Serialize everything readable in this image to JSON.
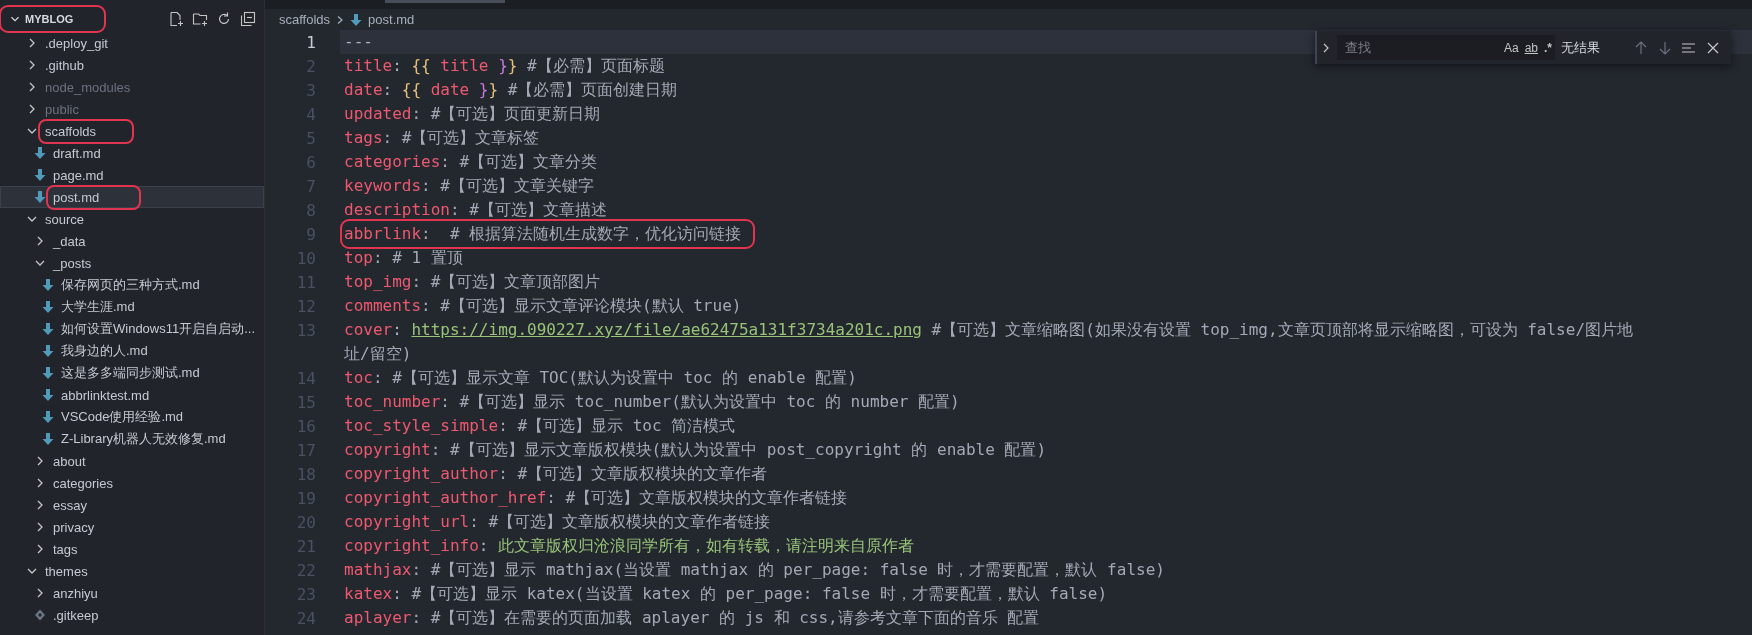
{
  "explorer": {
    "title": "MYBLOG",
    "expanded": true,
    "annotated": true,
    "tree": [
      {
        "name": ".deploy_git",
        "kind": "folder",
        "expanded": false,
        "dimmed": false,
        "selected": false,
        "annotated": false
      },
      {
        "name": ".github",
        "kind": "folder",
        "expanded": false,
        "dimmed": false,
        "selected": false,
        "annotated": false
      },
      {
        "name": "node_modules",
        "kind": "folder",
        "expanded": false,
        "dimmed": true,
        "selected": false,
        "annotated": false
      },
      {
        "name": "public",
        "kind": "folder",
        "expanded": false,
        "dimmed": true,
        "selected": false,
        "annotated": false
      },
      {
        "name": "scaffolds",
        "kind": "folder",
        "expanded": true,
        "dimmed": false,
        "selected": false,
        "annotated": true,
        "children": [
          {
            "name": "draft.md",
            "kind": "markdown",
            "dimmed": false,
            "selected": false,
            "annotated": false
          },
          {
            "name": "page.md",
            "kind": "markdown",
            "dimmed": false,
            "selected": false,
            "annotated": false
          },
          {
            "name": "post.md",
            "kind": "markdown",
            "dimmed": false,
            "selected": true,
            "annotated": true
          }
        ]
      },
      {
        "name": "source",
        "kind": "folder",
        "expanded": true,
        "dimmed": false,
        "selected": false,
        "annotated": false,
        "children": [
          {
            "name": "_data",
            "kind": "folder",
            "expanded": false,
            "dimmed": false,
            "selected": false,
            "annotated": false
          },
          {
            "name": "_posts",
            "kind": "folder",
            "expanded": true,
            "dimmed": false,
            "selected": false,
            "annotated": false,
            "children": [
              {
                "name": "保存网页的三种方式.md",
                "kind": "markdown",
                "dimmed": false,
                "selected": false,
                "annotated": false
              },
              {
                "name": "大学生涯.md",
                "kind": "markdown",
                "dimmed": false,
                "selected": false,
                "annotated": false
              },
              {
                "name": "如何设置Windows11开启自启动...",
                "kind": "markdown",
                "dimmed": false,
                "selected": false,
                "annotated": false
              },
              {
                "name": "我身边的人.md",
                "kind": "markdown",
                "dimmed": false,
                "selected": false,
                "annotated": false
              },
              {
                "name": "这是多多端同步测试.md",
                "kind": "markdown",
                "dimmed": false,
                "selected": false,
                "annotated": false
              },
              {
                "name": "abbrlinktest.md",
                "kind": "markdown",
                "dimmed": false,
                "selected": false,
                "annotated": false
              },
              {
                "name": "VSCode使用经验.md",
                "kind": "markdown",
                "dimmed": false,
                "selected": false,
                "annotated": false
              },
              {
                "name": "Z-Library机器人无效修复.md",
                "kind": "markdown",
                "dimmed": false,
                "selected": false,
                "annotated": false
              }
            ]
          },
          {
            "name": "about",
            "kind": "folder",
            "expanded": false,
            "dimmed": false,
            "selected": false,
            "annotated": false
          },
          {
            "name": "categories",
            "kind": "folder",
            "expanded": false,
            "dimmed": false,
            "selected": false,
            "annotated": false
          },
          {
            "name": "essay",
            "kind": "folder",
            "expanded": false,
            "dimmed": false,
            "selected": false,
            "annotated": false
          },
          {
            "name": "privacy",
            "kind": "folder",
            "expanded": false,
            "dimmed": false,
            "selected": false,
            "annotated": false
          },
          {
            "name": "tags",
            "kind": "folder",
            "expanded": false,
            "dimmed": false,
            "selected": false,
            "annotated": false
          }
        ]
      },
      {
        "name": "themes",
        "kind": "folder",
        "expanded": true,
        "dimmed": false,
        "selected": false,
        "annotated": false,
        "children": [
          {
            "name": "anzhiyu",
            "kind": "folder",
            "expanded": false,
            "dimmed": false,
            "selected": false,
            "annotated": false
          },
          {
            "name": ".gitkeep",
            "kind": "file",
            "dimmed": false,
            "selected": false,
            "annotated": false
          }
        ]
      }
    ]
  },
  "breadcrumb": [
    {
      "text": "scaffolds",
      "kind": "folder"
    },
    {
      "text": "post.md",
      "kind": "markdown"
    }
  ],
  "editor": {
    "lines": [
      {
        "number": "1",
        "current": true,
        "annotated": false,
        "segments": [
          {
            "kind": "punct",
            "text": "---"
          }
        ]
      },
      {
        "number": "2",
        "current": false,
        "annotated": false,
        "segments": [
          {
            "kind": "key",
            "text": "title"
          },
          {
            "kind": "punct",
            "text": ": "
          },
          {
            "kind": "bracket-gold",
            "text": "{{"
          },
          {
            "kind": "key",
            "text": " title "
          },
          {
            "kind": "bracket-purple",
            "text": "}"
          },
          {
            "kind": "bracket-gold",
            "text": "}"
          },
          {
            "kind": "comment",
            "text": " #【必需】页面标题"
          }
        ]
      },
      {
        "number": "3",
        "current": false,
        "annotated": false,
        "segments": [
          {
            "kind": "key",
            "text": "date"
          },
          {
            "kind": "punct",
            "text": ": "
          },
          {
            "kind": "bracket-gold",
            "text": "{{"
          },
          {
            "kind": "key",
            "text": " date "
          },
          {
            "kind": "bracket-purple",
            "text": "}"
          },
          {
            "kind": "bracket-gold",
            "text": "}"
          },
          {
            "kind": "comment",
            "text": " #【必需】页面创建日期"
          }
        ]
      },
      {
        "number": "4",
        "current": false,
        "annotated": false,
        "segments": [
          {
            "kind": "key",
            "text": "updated"
          },
          {
            "kind": "comment",
            "text": ": #【可选】页面更新日期"
          }
        ]
      },
      {
        "number": "5",
        "current": false,
        "annotated": false,
        "segments": [
          {
            "kind": "key",
            "text": "tags"
          },
          {
            "kind": "comment",
            "text": ": #【可选】文章标签"
          }
        ]
      },
      {
        "number": "6",
        "current": false,
        "annotated": false,
        "segments": [
          {
            "kind": "key",
            "text": "categories"
          },
          {
            "kind": "comment",
            "text": ": #【可选】文章分类"
          }
        ]
      },
      {
        "number": "7",
        "current": false,
        "annotated": false,
        "segments": [
          {
            "kind": "key",
            "text": "keywords"
          },
          {
            "kind": "comment",
            "text": ": #【可选】文章关键字"
          }
        ]
      },
      {
        "number": "8",
        "current": false,
        "annotated": false,
        "segments": [
          {
            "kind": "key",
            "text": "description"
          },
          {
            "kind": "comment",
            "text": ": #【可选】文章描述"
          }
        ]
      },
      {
        "number": "9",
        "current": false,
        "annotated": true,
        "segments": [
          {
            "kind": "key",
            "text": "abbrlink"
          },
          {
            "kind": "comment",
            "text": ":  # 根据算法随机生成数字，优化访问链接"
          }
        ]
      },
      {
        "number": "10",
        "current": false,
        "annotated": false,
        "segments": [
          {
            "kind": "key",
            "text": "top"
          },
          {
            "kind": "comment",
            "text": ": # 1 置顶"
          }
        ]
      },
      {
        "number": "11",
        "current": false,
        "annotated": false,
        "segments": [
          {
            "kind": "key",
            "text": "top_img"
          },
          {
            "kind": "comment",
            "text": ": #【可选】文章顶部图片"
          }
        ]
      },
      {
        "number": "12",
        "current": false,
        "annotated": false,
        "segments": [
          {
            "kind": "key",
            "text": "comments"
          },
          {
            "kind": "comment",
            "text": ": #【可选】显示文章评论模块(默认 true)"
          }
        ]
      },
      {
        "number": "13",
        "current": false,
        "annotated": false,
        "segments": [
          {
            "kind": "key",
            "text": "cover"
          },
          {
            "kind": "punct",
            "text": ": "
          },
          {
            "kind": "url",
            "text": "https://img.090227.xyz/file/ae62475a131f3734a201c.png"
          },
          {
            "kind": "comment",
            "text": " #【可选】文章缩略图(如果没有设置 top_img,文章页顶部将显示缩略图，可设为 false/图片地"
          }
        ],
        "wrap_segments": [
          {
            "kind": "comment",
            "text": "址/留空)"
          }
        ]
      },
      {
        "number": "14",
        "current": false,
        "annotated": false,
        "segments": [
          {
            "kind": "key",
            "text": "toc"
          },
          {
            "kind": "comment",
            "text": ": #【可选】显示文章 TOC(默认为设置中 toc 的 enable 配置)"
          }
        ]
      },
      {
        "number": "15",
        "current": false,
        "annotated": false,
        "segments": [
          {
            "kind": "key",
            "text": "toc_number"
          },
          {
            "kind": "comment",
            "text": ": #【可选】显示 toc_number(默认为设置中 toc 的 number 配置)"
          }
        ]
      },
      {
        "number": "16",
        "current": false,
        "annotated": false,
        "segments": [
          {
            "kind": "key",
            "text": "toc_style_simple"
          },
          {
            "kind": "comment",
            "text": ": #【可选】显示 toc 简洁模式"
          }
        ]
      },
      {
        "number": "17",
        "current": false,
        "annotated": false,
        "segments": [
          {
            "kind": "key",
            "text": "copyright"
          },
          {
            "kind": "comment",
            "text": ": #【可选】显示文章版权模块(默认为设置中 post_copyright 的 enable 配置)"
          }
        ]
      },
      {
        "number": "18",
        "current": false,
        "annotated": false,
        "segments": [
          {
            "kind": "key",
            "text": "copyright_author"
          },
          {
            "kind": "comment",
            "text": ": #【可选】文章版权模块的文章作者"
          }
        ]
      },
      {
        "number": "19",
        "current": false,
        "annotated": false,
        "segments": [
          {
            "kind": "key",
            "text": "copyright_author_href"
          },
          {
            "kind": "comment",
            "text": ": #【可选】文章版权模块的文章作者链接"
          }
        ]
      },
      {
        "number": "20",
        "current": false,
        "annotated": false,
        "segments": [
          {
            "kind": "key",
            "text": "copyright_url"
          },
          {
            "kind": "comment",
            "text": ": #【可选】文章版权模块的文章作者链接"
          }
        ]
      },
      {
        "number": "21",
        "current": false,
        "annotated": false,
        "segments": [
          {
            "kind": "key",
            "text": "copyright_info"
          },
          {
            "kind": "punct",
            "text": ": "
          },
          {
            "kind": "string",
            "text": "此文章版权归沧浪同学所有，如有转载，请注明来自原作者"
          }
        ]
      },
      {
        "number": "22",
        "current": false,
        "annotated": false,
        "segments": [
          {
            "kind": "key",
            "text": "mathjax"
          },
          {
            "kind": "comment",
            "text": ": #【可选】显示 mathjax(当设置 mathjax 的 per_page: false 时，才需要配置，默认 false)"
          }
        ]
      },
      {
        "number": "23",
        "current": false,
        "annotated": false,
        "segments": [
          {
            "kind": "key",
            "text": "katex"
          },
          {
            "kind": "comment",
            "text": ": #【可选】显示 katex(当设置 katex 的 per_page: false 时，才需要配置，默认 false)"
          }
        ]
      },
      {
        "number": "24",
        "current": false,
        "annotated": false,
        "segments": [
          {
            "kind": "key",
            "text": "aplayer"
          },
          {
            "kind": "comment",
            "text": ": #【可选】在需要的页面加载 aplayer 的 js 和 css,请参考文章下面的音乐 配置"
          }
        ]
      }
    ]
  },
  "find_widget": {
    "placeholder": "查找",
    "options": [
      "Aa",
      "ab",
      ".*"
    ],
    "result": "无结果"
  }
}
